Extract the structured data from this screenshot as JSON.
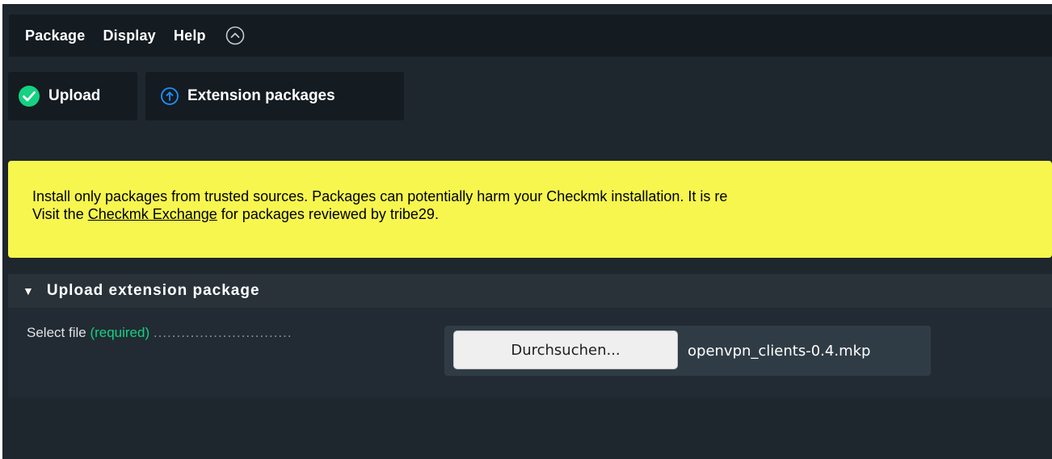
{
  "menubar": {
    "items": [
      {
        "label": "Package"
      },
      {
        "label": "Display"
      },
      {
        "label": "Help"
      }
    ],
    "toggle_icon": "chevron-up-circle-icon"
  },
  "page_buttons": {
    "upload": {
      "label": "Upload",
      "icon": "check-circle-icon",
      "icon_color": "#15d182"
    },
    "extension_packages": {
      "label": "Extension packages",
      "icon": "upload-circle-icon",
      "icon_color": "#1e90ff"
    }
  },
  "warning": {
    "line1": "Install only packages from trusted sources. Packages can potentially harm your Checkmk installation. It is re",
    "line2_prefix": "Visit the ",
    "link_text": "Checkmk Exchange",
    "line2_suffix": " for packages reviewed by tribe29.",
    "background": "#f6f64e"
  },
  "upload_section": {
    "title": "Upload extension package",
    "field": {
      "label": "Select file",
      "required": "(required)",
      "dots": " ..............................",
      "browse_label": "Durchsuchen...",
      "file_name": "openvpn_clients-0.4.mkp"
    }
  },
  "colors": {
    "app_background": "#1e262e",
    "accent_green": "#15d182"
  }
}
